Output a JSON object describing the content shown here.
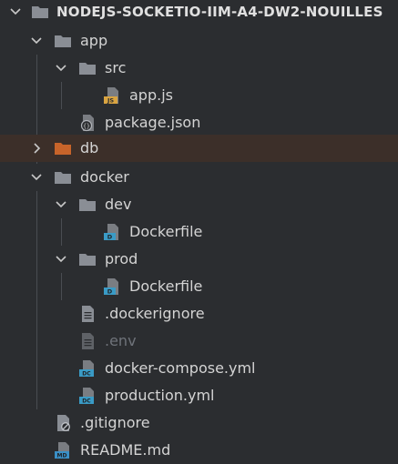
{
  "tree": {
    "root": {
      "label": "NODEJS-SOCKETIO-IIM-A4-DW2-NOUILLES",
      "icon": "folder-icon"
    },
    "items": [
      {
        "label": "app",
        "icon": "folder-icon",
        "expanded": true
      },
      {
        "label": "src",
        "icon": "folder-icon",
        "expanded": true
      },
      {
        "label": "app.js",
        "icon": "js-file-icon",
        "badge": "JS"
      },
      {
        "label": "package.json",
        "icon": "json-file-icon"
      },
      {
        "label": "db",
        "icon": "folder-icon",
        "expanded": false,
        "selected": true
      },
      {
        "label": "docker",
        "icon": "folder-icon",
        "expanded": true
      },
      {
        "label": "dev",
        "icon": "folder-icon",
        "expanded": true
      },
      {
        "label": "Dockerfile",
        "icon": "dockerfile-icon",
        "badge": "D"
      },
      {
        "label": "prod",
        "icon": "folder-icon",
        "expanded": true
      },
      {
        "label": "Dockerfile",
        "icon": "dockerfile-icon",
        "badge": "D"
      },
      {
        "label": ".dockerignore",
        "icon": "text-file-icon"
      },
      {
        "label": ".env",
        "icon": "text-file-icon",
        "dimmed": true
      },
      {
        "label": "docker-compose.yml",
        "icon": "docker-compose-icon",
        "badge": "DC"
      },
      {
        "label": "production.yml",
        "icon": "docker-compose-icon",
        "badge": "DC"
      },
      {
        "label": ".gitignore",
        "icon": "gitignore-icon"
      },
      {
        "label": "README.md",
        "icon": "markdown-icon",
        "badge": "MD"
      }
    ]
  },
  "colors": {
    "background": "#2b2d30",
    "selected_row": "#3c2f29",
    "folder": "#8a8e95",
    "db_folder": "#c8642a",
    "js_badge": "#d9a441",
    "docker_badge": "#3a9bc6",
    "markdown_badge": "#3a8fc6"
  }
}
